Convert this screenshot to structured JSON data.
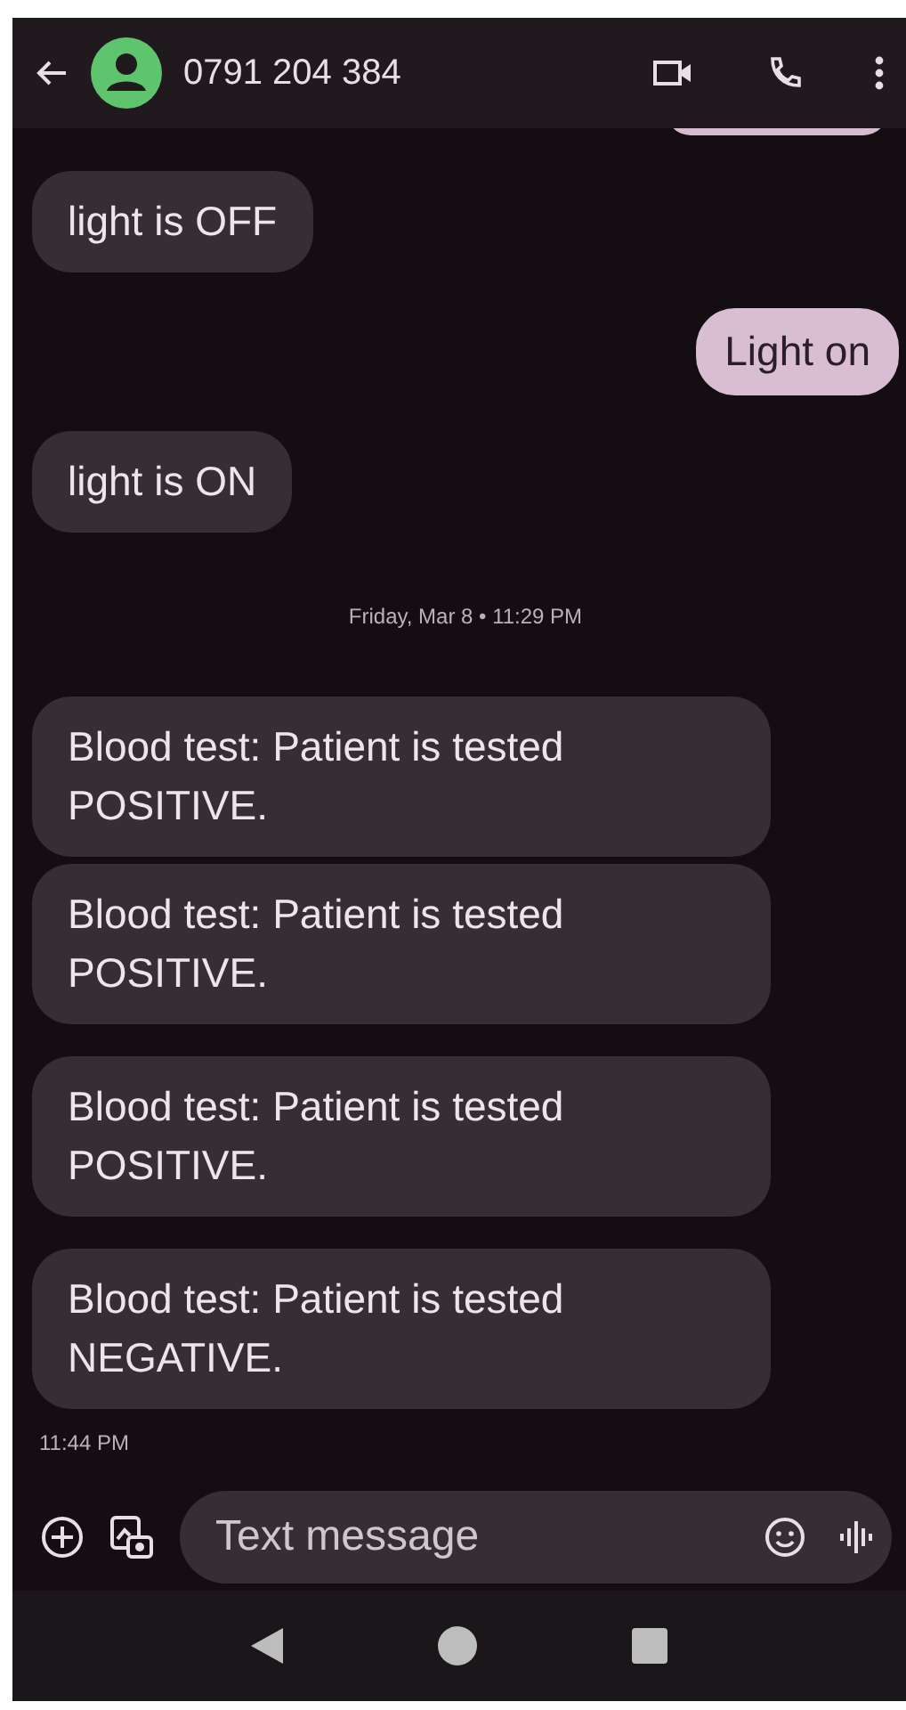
{
  "header": {
    "contact": "0791 204 384"
  },
  "messages": [
    {
      "kind": "incoming",
      "text": "light is OFF"
    },
    {
      "kind": "outgoing",
      "text": "Light on"
    },
    {
      "kind": "incoming",
      "text": "light is ON"
    },
    {
      "kind": "date",
      "text": "Friday, Mar 8 • 11:29 PM"
    },
    {
      "kind": "incoming",
      "text": "Blood test: Patient is tested POSITIVE."
    },
    {
      "kind": "incoming",
      "text": "Blood test: Patient is tested POSITIVE."
    },
    {
      "kind": "incoming",
      "text": "Blood test: Patient is tested POSITIVE."
    },
    {
      "kind": "incoming",
      "text": "Blood test: Patient is tested NEGATIVE."
    },
    {
      "kind": "time",
      "text": "11:44 PM"
    }
  ],
  "compose": {
    "placeholder": "Text message"
  }
}
